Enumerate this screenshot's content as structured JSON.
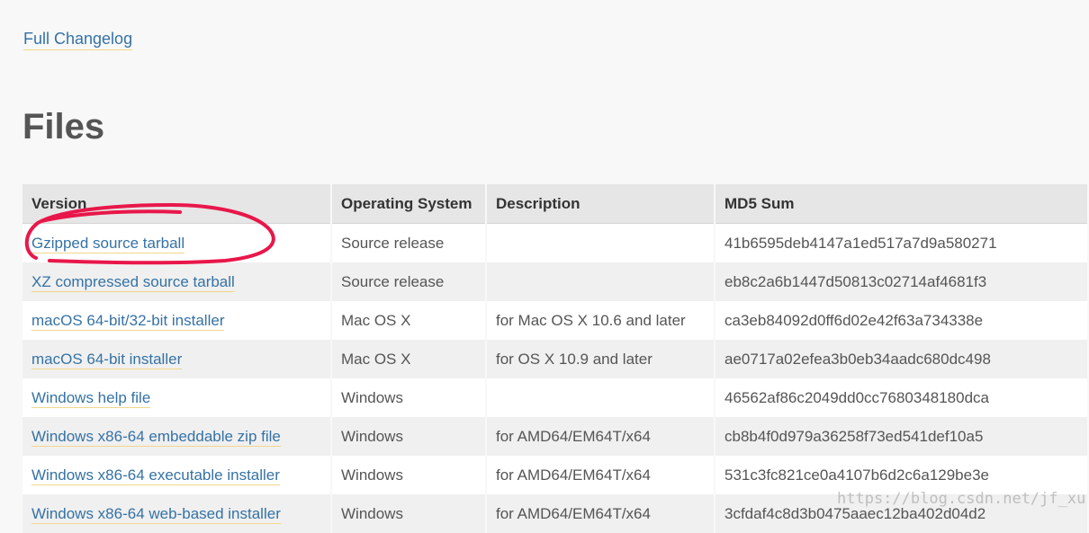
{
  "changelog": {
    "label": "Full Changelog"
  },
  "files": {
    "heading": "Files",
    "columns": {
      "version": "Version",
      "os": "Operating System",
      "description": "Description",
      "md5": "MD5 Sum"
    },
    "rows": [
      {
        "version": "Gzipped source tarball",
        "os": "Source release",
        "description": "",
        "md5": "41b6595deb4147a1ed517a7d9a580271"
      },
      {
        "version": "XZ compressed source tarball",
        "os": "Source release",
        "description": "",
        "md5": "eb8c2a6b1447d50813c02714af4681f3"
      },
      {
        "version": "macOS 64-bit/32-bit installer",
        "os": "Mac OS X",
        "description": "for Mac OS X 10.6 and later",
        "md5": "ca3eb84092d0ff6d02e42f63a734338e"
      },
      {
        "version": "macOS 64-bit installer",
        "os": "Mac OS X",
        "description": "for OS X 10.9 and later",
        "md5": "ae0717a02efea3b0eb34aadc680dc498"
      },
      {
        "version": "Windows help file",
        "os": "Windows",
        "description": "",
        "md5": "46562af86c2049dd0cc7680348180dca"
      },
      {
        "version": "Windows x86-64 embeddable zip file",
        "os": "Windows",
        "description": "for AMD64/EM64T/x64",
        "md5": "cb8b4f0d979a36258f73ed541def10a5"
      },
      {
        "version": "Windows x86-64 executable installer",
        "os": "Windows",
        "description": "for AMD64/EM64T/x64",
        "md5": "531c3fc821ce0a4107b6d2c6a129be3e"
      },
      {
        "version": "Windows x86-64 web-based installer",
        "os": "Windows",
        "description": "for AMD64/EM64T/x64",
        "md5": "3cfdaf4c8d3b0475aaec12ba402d04d2"
      }
    ]
  },
  "annotation": {
    "color": "#e8174a",
    "target": "Gzipped source tarball"
  },
  "watermark": {
    "text": "https://blog.csdn.net/jf_xu"
  },
  "colors": {
    "link": "#3572a5",
    "link_underline": "#f0d78c",
    "header_bg": "#e6e6e6"
  }
}
